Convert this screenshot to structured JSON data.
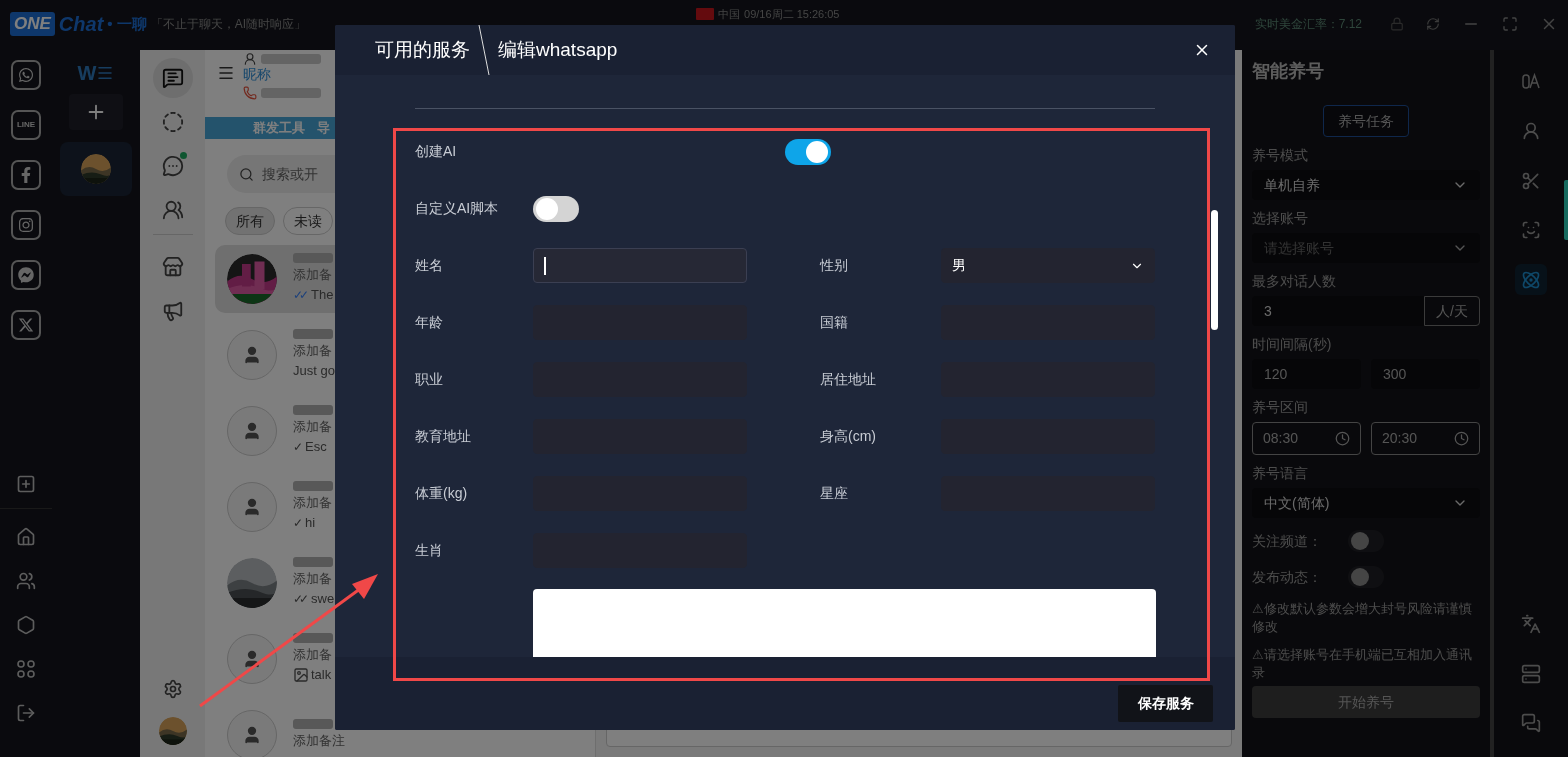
{
  "top_bar": {
    "logo_badge": "ONE",
    "logo_text": "Chat",
    "logo_suffix": "• 一聊",
    "slogan": "「不止于聊天，AI随时响应」",
    "region": "中国",
    "datetime": "09/16周二 15:26:05",
    "exchange_rate": "实时美金汇率：7.12"
  },
  "app_rail": {
    "line_label": "LINE"
  },
  "accounts": {
    "header": "W",
    "items": [
      {
        "selected": true
      }
    ]
  },
  "chat_nav": [
    {
      "selected": true,
      "badge": false
    },
    {
      "selected": false,
      "badge": false
    },
    {
      "selected": false,
      "badge": true
    },
    {
      "selected": false,
      "badge": false
    },
    {
      "selected": false,
      "badge": false
    },
    {
      "selected": false,
      "badge": false
    }
  ],
  "chat_list": {
    "nickname": "昵称",
    "toolbar_label": "群发工具",
    "toolbar_label_2": "导",
    "search": {
      "placeholder": "搜索或开"
    },
    "filters": [
      {
        "label": "所有",
        "selected": true
      },
      {
        "label": "未读",
        "selected": false
      }
    ],
    "chats": [
      {
        "selected": true,
        "note": "添加备",
        "tick": "✓✓",
        "read": true,
        "image": false,
        "preview": "The"
      },
      {
        "kind": "person",
        "selected": false,
        "note": "添加备",
        "image": false,
        "preview": "Just go"
      },
      {
        "kind": "person",
        "selected": false,
        "note": "添加备",
        "tick": "✓",
        "read": false,
        "image": false,
        "preview": "Esc"
      },
      {
        "kind": "person",
        "selected": false,
        "note": "添加备",
        "tick": "✓",
        "read": false,
        "image": false,
        "preview": "hi"
      },
      {
        "selected": false,
        "note": "添加备",
        "tick": "✓✓",
        "read": false,
        "image": false,
        "preview": "swe"
      },
      {
        "kind": "person",
        "selected": false,
        "note": "添加备",
        "image": true,
        "preview": "talk"
      },
      {
        "kind": "person",
        "selected": false,
        "note": "添加备注"
      }
    ]
  },
  "modal": {
    "breadcrumb": [
      "可用的服务",
      "编辑whatsapp"
    ],
    "toggles": [
      {
        "label": "创建AI",
        "on": true
      },
      {
        "label": "自定义AI脚本",
        "on": false
      }
    ],
    "fields": [
      {
        "label": "姓名",
        "kind": "text",
        "focused": true
      },
      {
        "label": "性别",
        "kind": "select",
        "value": "男"
      },
      {
        "label": "年龄",
        "kind": "text",
        "focused": false
      },
      {
        "label": "国籍",
        "kind": "text",
        "focused": false
      },
      {
        "label": "职业",
        "kind": "text",
        "focused": false
      },
      {
        "label": "居住地址",
        "kind": "text",
        "focused": false
      },
      {
        "label": "教育地址",
        "kind": "text",
        "focused": false
      },
      {
        "label": "身高(cm)",
        "kind": "text",
        "focused": false
      },
      {
        "label": "体重(kg)",
        "kind": "text",
        "focused": false
      },
      {
        "label": "星座",
        "kind": "text",
        "focused": false
      },
      {
        "label": "生肖",
        "kind": "text",
        "focused": false
      }
    ],
    "save_button": "保存服务"
  },
  "right_panel": {
    "title": "智能养号",
    "task_button": "养号任务",
    "mode": {
      "label": "养号模式",
      "value": "单机自养"
    },
    "account": {
      "label": "选择账号",
      "placeholder": "请选择账号"
    },
    "max_chats": {
      "label": "最多对话人数",
      "value": "3",
      "unit": "人/天"
    },
    "interval": {
      "label": "时间间隔(秒)",
      "min": "120",
      "max": "300"
    },
    "schedule": {
      "label": "养号区间",
      "start": "08:30",
      "end": "20:30"
    },
    "language": {
      "label": "养号语言",
      "value": "中文(简体)"
    },
    "switches": [
      {
        "label": "关注频道：",
        "on": false
      },
      {
        "label": "发布动态：",
        "on": false
      }
    ],
    "warnings": [
      "⚠修改默认参数会增大封号风险请谨慎修改",
      "⚠请选择账号在手机端已互相加入通讯录"
    ],
    "start_button": {
      "label": "开始养号",
      "disabled": true
    }
  },
  "right_toolbar": [
    {
      "selected": false
    },
    {
      "selected": false
    },
    {
      "selected": false
    },
    {
      "selected": false
    },
    {
      "selected": true
    },
    {
      "selected": false
    },
    {
      "selected": false
    },
    {
      "selected": false
    }
  ]
}
